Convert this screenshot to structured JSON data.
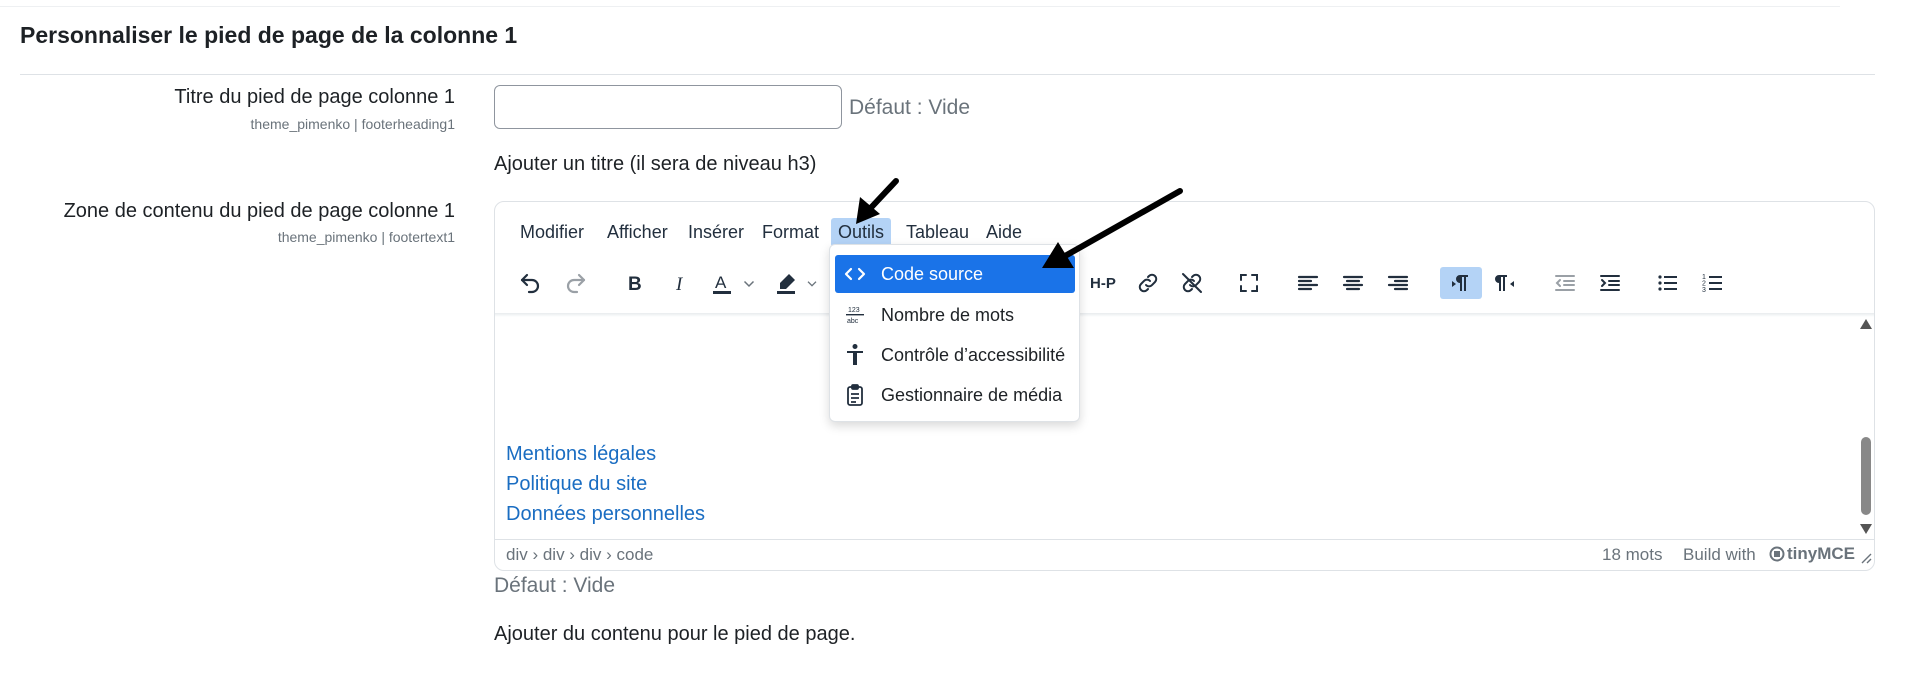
{
  "section": {
    "title": "Personnaliser le pied de page de la colonne 1"
  },
  "field1": {
    "label": "Titre du pied de page colonne 1",
    "setting": "theme_pimenko | footerheading1",
    "value": "",
    "default": "Défaut : Vide",
    "description": "Ajouter un titre (il sera de niveau h3)"
  },
  "field2": {
    "label": "Zone de contenu du pied de page colonne 1",
    "setting": "theme_pimenko | footertext1",
    "default": "Défaut : Vide",
    "description": "Ajouter du contenu pour le pied de page."
  },
  "editor": {
    "menubar": [
      "Modifier",
      "Afficher",
      "Insérer",
      "Format",
      "Outils",
      "Tableau",
      "Aide"
    ],
    "active_menu": "Outils",
    "toolbar_icons": [
      "undo-icon",
      "redo-icon",
      "bold-icon",
      "italic-icon",
      "text-color-icon",
      "highlight-color-icon",
      "h5p-icon",
      "link-icon",
      "unlink-icon",
      "fullscreen-icon",
      "align-left-icon",
      "align-center-icon",
      "align-right-icon",
      "ltr-icon",
      "rtl-icon",
      "outdent-icon",
      "indent-icon",
      "bullet-list-icon",
      "numbered-list-icon"
    ],
    "content_links": [
      "Mentions légales",
      "Politique du site",
      "Données personnelles"
    ],
    "statusbar": {
      "path": "div › div › div › code",
      "word_count": "18 mots",
      "build_with": "Build with",
      "brand": "tinyMCE"
    },
    "tools_menu": [
      {
        "label": "Code source",
        "icon": "code-icon",
        "highlighted": true
      },
      {
        "label": "Nombre de mots",
        "icon": "word-count-icon",
        "highlighted": false
      },
      {
        "label": "Contrôle d’accessibilité",
        "icon": "accessibility-icon",
        "highlighted": false
      },
      {
        "label": "Gestionnaire de média",
        "icon": "media-manager-icon",
        "highlighted": false
      }
    ]
  },
  "colors": {
    "accent": "#1a73e8",
    "active_menu_bg": "#b4d3f6",
    "link": "#1a6dc2"
  }
}
